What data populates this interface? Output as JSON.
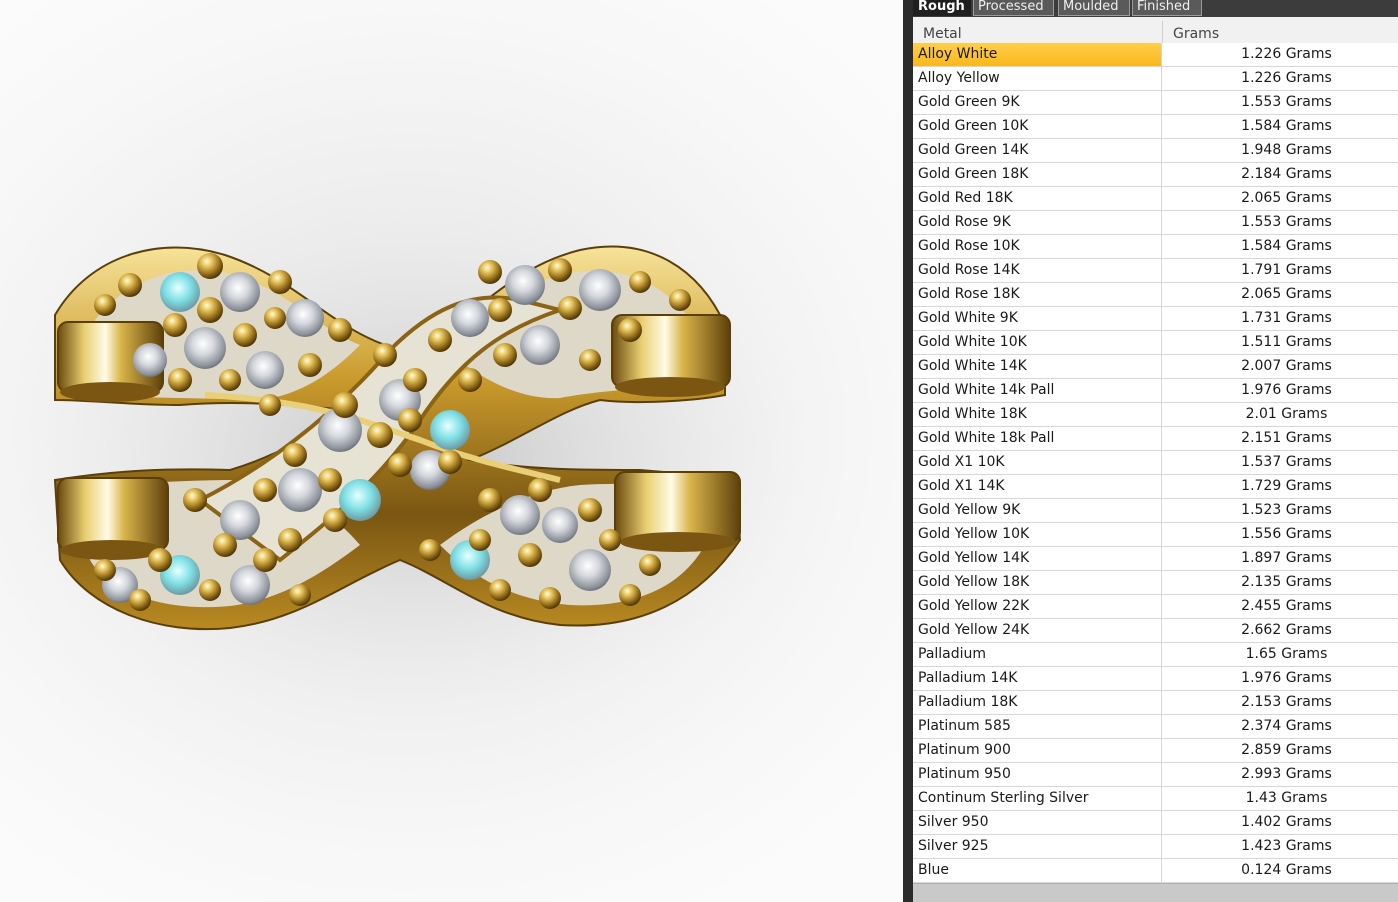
{
  "tabs": [
    "Rough",
    "Processed",
    "Moulded",
    "Finished"
  ],
  "active_tab": "Rough",
  "table": {
    "headers": [
      "Metal",
      "Grams"
    ],
    "selected_row": 0,
    "rows": [
      {
        "metal": "Alloy White",
        "grams": "1.226 Grams"
      },
      {
        "metal": "Alloy Yellow",
        "grams": "1.226 Grams"
      },
      {
        "metal": "Gold Green 9K",
        "grams": "1.553 Grams"
      },
      {
        "metal": "Gold Green 10K",
        "grams": "1.584 Grams"
      },
      {
        "metal": "Gold Green 14K",
        "grams": "1.948 Grams"
      },
      {
        "metal": "Gold Green 18K",
        "grams": "2.184 Grams"
      },
      {
        "metal": "Gold Red 18K",
        "grams": "2.065 Grams"
      },
      {
        "metal": "Gold Rose 9K",
        "grams": "1.553 Grams"
      },
      {
        "metal": "Gold Rose 10K",
        "grams": "1.584 Grams"
      },
      {
        "metal": "Gold Rose 14K",
        "grams": "1.791 Grams"
      },
      {
        "metal": "Gold Rose 18K",
        "grams": "2.065 Grams"
      },
      {
        "metal": "Gold White 9K",
        "grams": "1.731 Grams"
      },
      {
        "metal": "Gold White 10K",
        "grams": "1.511 Grams"
      },
      {
        "metal": "Gold White 14K",
        "grams": "2.007 Grams"
      },
      {
        "metal": "Gold White 14k Pall",
        "grams": "1.976 Grams"
      },
      {
        "metal": "Gold White 18K",
        "grams": "2.01 Grams"
      },
      {
        "metal": "Gold White 18k Pall",
        "grams": "2.151 Grams"
      },
      {
        "metal": "Gold X1 10K",
        "grams": "1.537 Grams"
      },
      {
        "metal": "Gold X1 14K",
        "grams": "1.729 Grams"
      },
      {
        "metal": "Gold Yellow 9K",
        "grams": "1.523 Grams"
      },
      {
        "metal": "Gold Yellow 10K",
        "grams": "1.556 Grams"
      },
      {
        "metal": "Gold Yellow 14K",
        "grams": "1.897 Grams"
      },
      {
        "metal": "Gold Yellow 18K",
        "grams": "2.135 Grams"
      },
      {
        "metal": "Gold Yellow 22K",
        "grams": "2.455 Grams"
      },
      {
        "metal": "Gold Yellow 24K",
        "grams": "2.662 Grams"
      },
      {
        "metal": "Palladium",
        "grams": "1.65 Grams"
      },
      {
        "metal": "Palladium 14K",
        "grams": "1.976 Grams"
      },
      {
        "metal": "Palladium 18K",
        "grams": "2.153 Grams"
      },
      {
        "metal": "Platinum 585",
        "grams": "2.374 Grams"
      },
      {
        "metal": "Platinum 900",
        "grams": "2.859 Grams"
      },
      {
        "metal": "Platinum 950",
        "grams": "2.993 Grams"
      },
      {
        "metal": "Continum Sterling Silver",
        "grams": "1.43 Grams"
      },
      {
        "metal": "Silver 950",
        "grams": "1.402 Grams"
      },
      {
        "metal": "Silver 925",
        "grams": "1.423 Grams"
      },
      {
        "metal": "Blue",
        "grams": "0.124 Grams"
      }
    ]
  },
  "colors": {
    "selection": "#f9b81e",
    "gold": "#c9a227",
    "panel_dark": "#2b2b2b"
  }
}
